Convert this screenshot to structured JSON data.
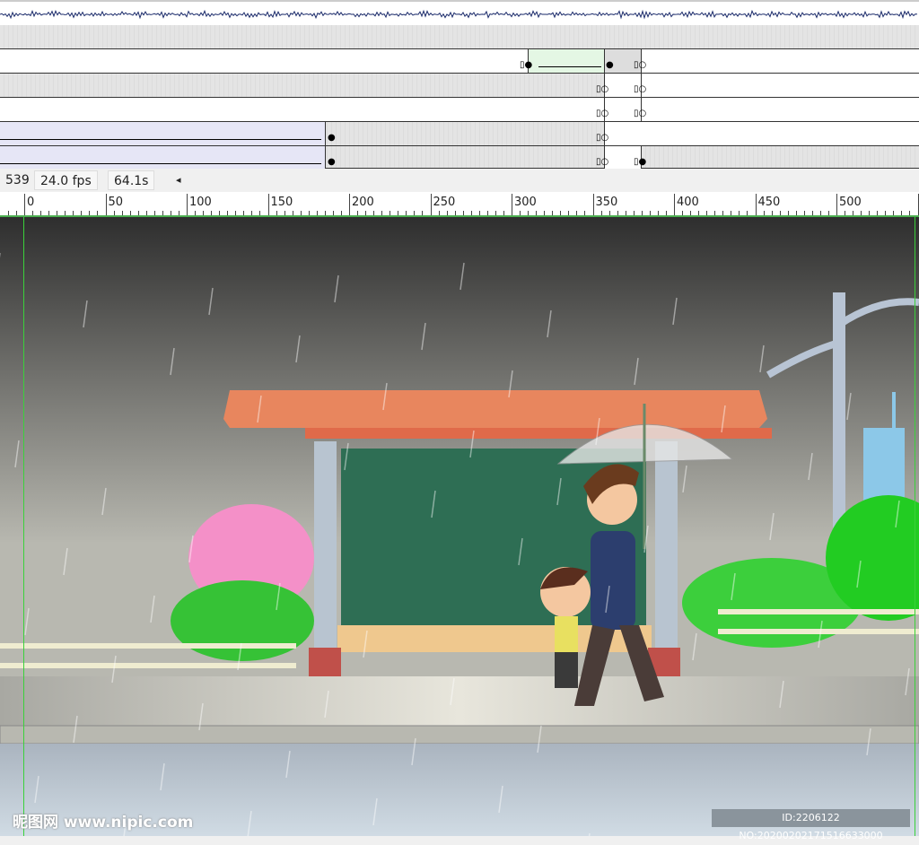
{
  "timeline": {
    "status": {
      "frame": "539",
      "fps": "24.0 fps",
      "time": "64.1s",
      "scroll_left": "◂"
    },
    "ruler_labels": [
      "0",
      "50",
      "100",
      "150",
      "200",
      "250",
      "300",
      "350",
      "400",
      "450",
      "500"
    ]
  },
  "watermark": {
    "left": "昵图网 www.nipic.com",
    "right": "ID:2206122 NO:20200202171516633000"
  },
  "colors": {
    "stage_top": "#2e2e2e",
    "stage_bottom": "#c8cfd6",
    "roof": "#e8865e",
    "guide": "#3ad13a"
  }
}
